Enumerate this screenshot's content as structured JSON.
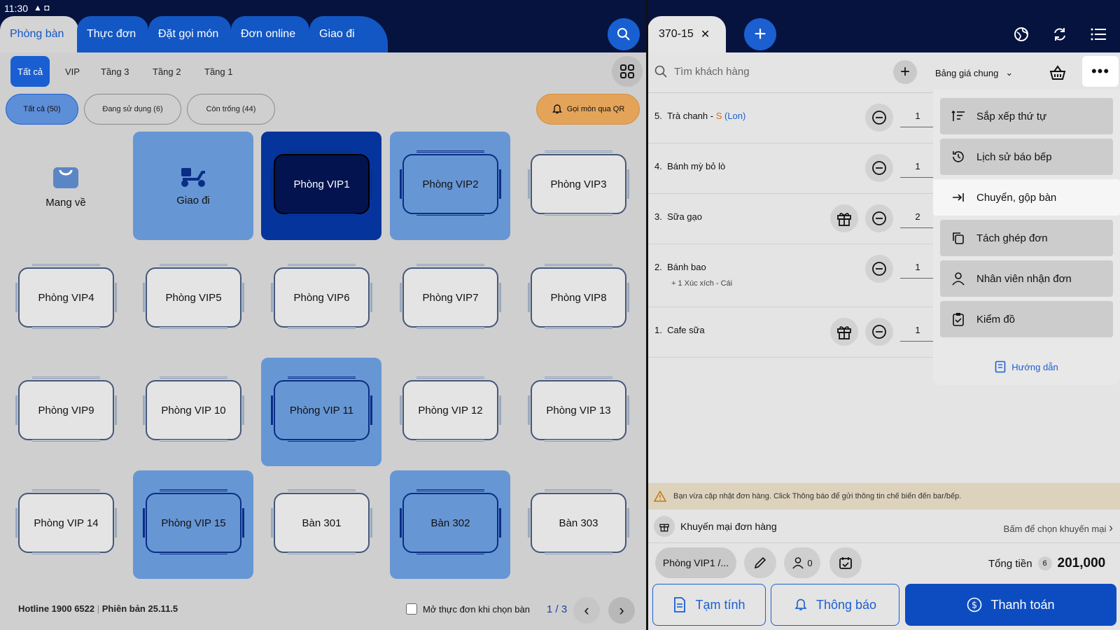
{
  "status": {
    "time": "11:30",
    "icons": "▲ ◘"
  },
  "tabs": [
    {
      "label": "Phòng bàn",
      "active": true
    },
    {
      "label": "Thực đơn"
    },
    {
      "label": "Đặt gọi món"
    },
    {
      "label": "Đơn online"
    },
    {
      "label": "Giao đi"
    }
  ],
  "floors": [
    "Tất cả",
    "VIP",
    "Tầng 3",
    "Tầng 2",
    "Tầng 1"
  ],
  "status_filters": [
    "Tất cả (50)",
    "Đang sử dụng (6)",
    "Còn trống (44)"
  ],
  "qr_label": "Gọi món qua QR",
  "tables": {
    "takeaway": "Mang về",
    "delivery": "Giao đi",
    "rooms": [
      "Phòng VIP1",
      "Phòng VIP2",
      "Phòng VIP3",
      "Phòng VIP4",
      "Phòng VIP5",
      "Phòng VIP6",
      "Phòng VIP7",
      "Phòng VIP8",
      "Phòng VIP9",
      "Phòng VIP 10",
      "Phòng VIP 11",
      "Phòng VIP 12",
      "Phòng VIP 13",
      "Phòng VIP 14",
      "Phòng VIP 15",
      "Bàn 301",
      "Bàn 302",
      "Bàn 303"
    ]
  },
  "footer": {
    "hotline": "Hotline 1900 6522",
    "version": "Phiên bản 25.11.5",
    "open_menu": "Mở thực đơn khi chọn bàn",
    "page": "1 / 3"
  },
  "order_tab": {
    "label": "370-15"
  },
  "customer": {
    "placeholder": "Tìm khách hàng"
  },
  "price_list": "Bảng giá chung",
  "items": [
    {
      "idx": "5.",
      "name": "Trà chanh",
      "dash": " - ",
      "size": "S",
      "unit": "(Lon)",
      "qty": "1",
      "gift": false,
      "sub": ""
    },
    {
      "idx": "4.",
      "name": "Bánh mỳ bỏ lò",
      "qty": "1",
      "gift": false,
      "sub": ""
    },
    {
      "idx": "3.",
      "name": "Sữa gạo",
      "qty": "2",
      "gift": true,
      "sub": ""
    },
    {
      "idx": "2.",
      "name": "Bánh bao",
      "qty": "1",
      "gift": false,
      "sub": "+ 1 Xúc xích - Cái"
    },
    {
      "idx": "1.",
      "name": "Cafe sữa",
      "qty": "1",
      "gift": true,
      "sub": ""
    }
  ],
  "menu": {
    "items": [
      "Sắp xếp thứ tự",
      "Lịch sử báo bếp",
      "Chuyển, gộp bàn",
      "Tách ghép đơn",
      "Nhân viên nhận đơn",
      "Kiểm đồ"
    ],
    "guide": "Hướng dẫn"
  },
  "warning": "Bạn vừa cập nhật đơn hàng. Click Thông báo để gửi thông tin chế biến đến bar/bếp.",
  "promo": {
    "label": "Khuyến mại đơn hàng",
    "hint": "Bấm để chọn khuyến mại"
  },
  "bottom": {
    "table_chip": "Phòng VIP1 /...",
    "guests": "0",
    "total_label": "Tổng tiền",
    "total_count": "6",
    "total_amount": "201,000",
    "provisional": "Tạm tính",
    "notify": "Thông báo",
    "pay": "Thanh toán"
  },
  "colors": {
    "navy": "#06133f",
    "primary": "#1a5fd2",
    "selected_tile": "#6796d4",
    "active_tile": "#06349d"
  }
}
